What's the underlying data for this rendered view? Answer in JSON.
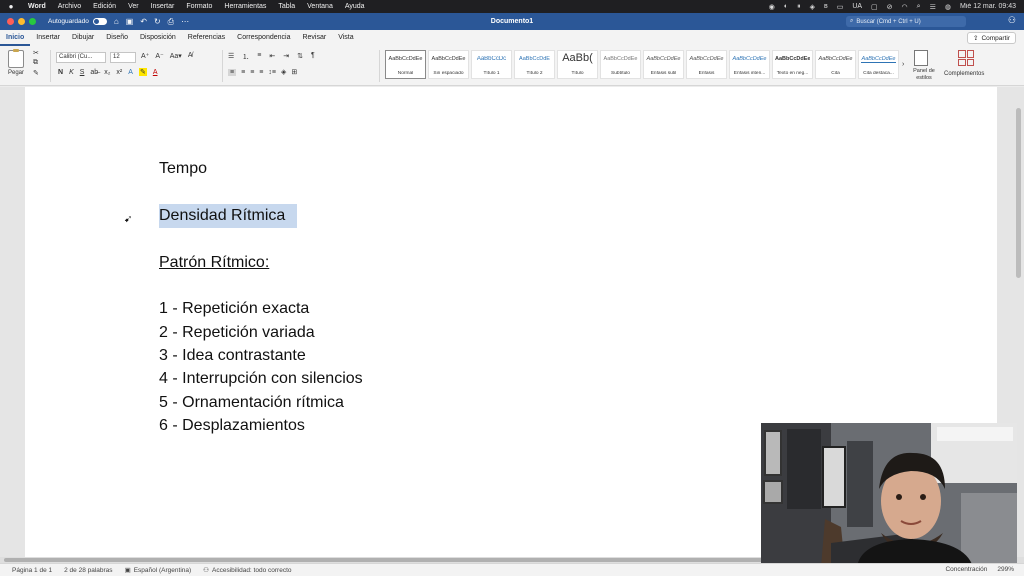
{
  "menubar": {
    "app": "Word",
    "items": [
      "Archivo",
      "Edición",
      "Ver",
      "Insertar",
      "Formato",
      "Herramientas",
      "Tabla",
      "Ventana",
      "Ayuda"
    ],
    "input_source": "UA",
    "datetime": "Mié 12 mar.  09:43"
  },
  "titlebar": {
    "autosave_label": "Autoguardado",
    "document_title": "Documento1",
    "search_placeholder": "Buscar (Cmd + Ctrl + U)"
  },
  "tabs": [
    "Inicio",
    "Insertar",
    "Dibujar",
    "Diseño",
    "Disposición",
    "Referencias",
    "Correspondencia",
    "Revisar",
    "Vista"
  ],
  "active_tab": "Inicio",
  "share_label": "Compartir",
  "ribbon": {
    "paste_label": "Pegar",
    "font_name": "Calibri (Cu...",
    "font_size": "12",
    "styles": [
      {
        "sample": "AaBbCcDdEe",
        "name": "Normal"
      },
      {
        "sample": "AaBbCcDdEe",
        "name": "Sin espaciado"
      },
      {
        "sample": "AaBbCcDc",
        "name": "Título 1"
      },
      {
        "sample": "AaBbCcDdE",
        "name": "Título 2"
      },
      {
        "sample": "AaBb(",
        "name": "Título"
      },
      {
        "sample": "AaBbCcDdEe",
        "name": "Subtítulo"
      },
      {
        "sample": "AaBbCcDdEe",
        "name": "Énfasis sutil"
      },
      {
        "sample": "AaBbCcDdEe",
        "name": "Énfasis"
      },
      {
        "sample": "AaBbCcDdEe",
        "name": "Énfasis inten..."
      },
      {
        "sample": "AaBbCcDdEe",
        "name": "Texto en neg..."
      },
      {
        "sample": "AaBbCcDdEe",
        "name": "Cita"
      },
      {
        "sample": "AaBbCcDdEe",
        "name": "Cita destaca..."
      }
    ],
    "panel_label": "Panel de estilos",
    "complements_label": "Complementos"
  },
  "document": {
    "lines": [
      "Tempo",
      "Densidad Rítmica",
      "Patrón Rítmico:",
      "1 - Repetición exacta",
      "2 - Repetición variada",
      "3 - Idea contrastante",
      "4 - Interrupción con silencios",
      "5 - Ornamentación rítmica",
      "6 - Desplazamientos"
    ]
  },
  "statusbar": {
    "page": "Página 1 de 1",
    "words": "2 de 28 palabras",
    "language": "Español (Argentina)",
    "accessibility": "Accesibilidad: todo correcto",
    "focus": "Concentración",
    "zoom": "299%"
  },
  "colors": {
    "titlebar": "#2b5797",
    "selection": "#c7d8ee",
    "heading_blue": "#2e74b5"
  }
}
